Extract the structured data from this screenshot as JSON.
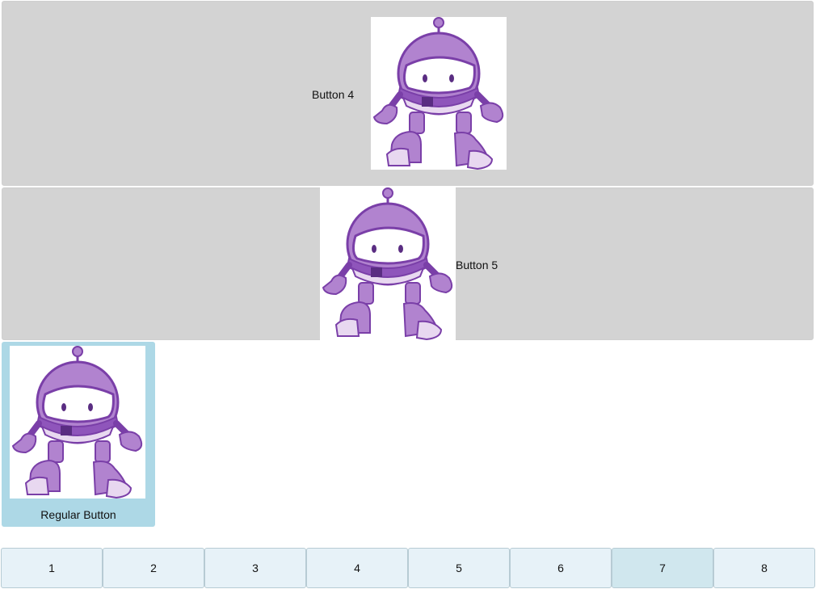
{
  "buttons": {
    "button4_label": "Button 4",
    "button5_label": "Button 5",
    "regular_label": "Regular Button"
  },
  "image": {
    "name": "dotnet-bot-robot"
  },
  "tabs": [
    {
      "label": "1",
      "active": false
    },
    {
      "label": "2",
      "active": false
    },
    {
      "label": "3",
      "active": false
    },
    {
      "label": "4",
      "active": false
    },
    {
      "label": "5",
      "active": false
    },
    {
      "label": "6",
      "active": false
    },
    {
      "label": "7",
      "active": true
    },
    {
      "label": "8",
      "active": false
    }
  ],
  "colors": {
    "button_gray": "#d3d3d3",
    "regular_button": "#add8e6",
    "tab_bg": "#e7f2f8",
    "tab_active_bg": "#d0e7ee",
    "robot_purple": "#a070c4",
    "robot_light": "#e8d8f0"
  }
}
